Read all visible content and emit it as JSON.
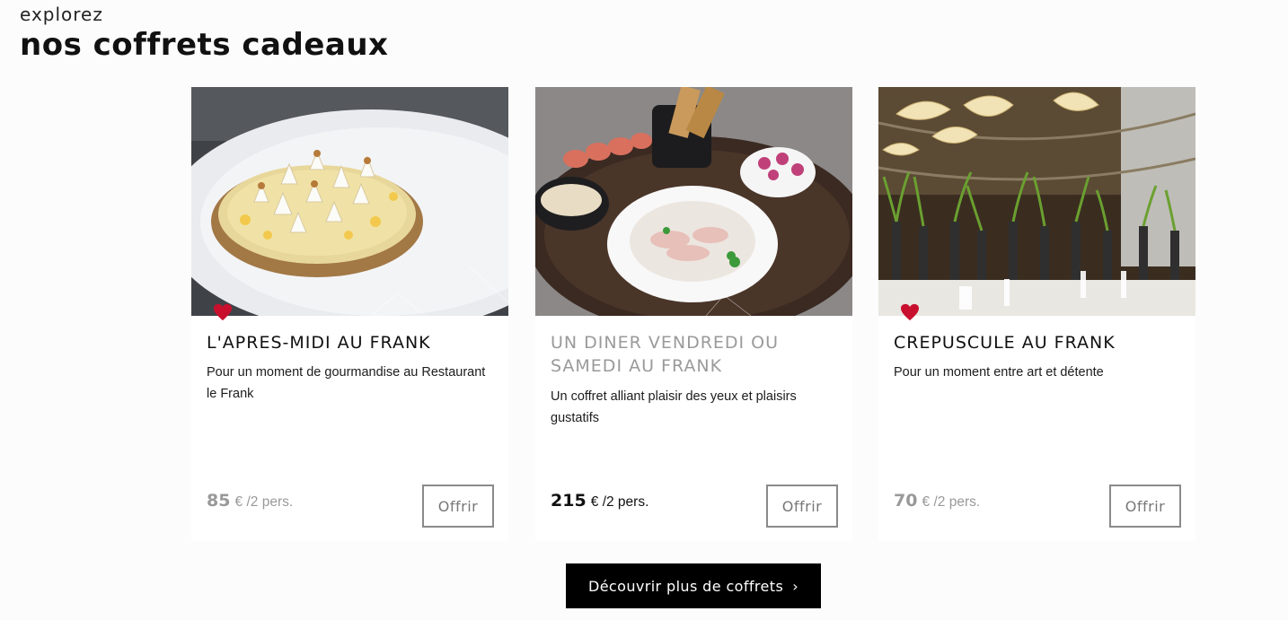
{
  "header": {
    "kicker": "explorez",
    "title": "nos coffrets cadeaux"
  },
  "cards": [
    {
      "title": "L'APRES-MIDI AU FRANK",
      "description": "Pour un moment de gourmandise au Restaurant le Frank",
      "price_amount": "85",
      "price_unit": "€ /2 pers.",
      "offer_label": "Offrir",
      "favorite": true,
      "image_icon": "tart-dessert-photo"
    },
    {
      "title": "UN DINER VENDREDI OU SAMEDI AU FRANK",
      "description": "Un coffret alliant plaisir des yeux et plaisirs gustatifs",
      "price_amount": "215",
      "price_unit": "€ /2 pers.",
      "offer_label": "Offrir",
      "favorite": false,
      "image_icon": "fish-platter-photo"
    },
    {
      "title": "CREPUSCULE AU FRANK",
      "description": "Pour un moment entre art et détente",
      "price_amount": "70",
      "price_unit": "€ /2 pers.",
      "offer_label": "Offrir",
      "favorite": true,
      "image_icon": "restaurant-interior-photo"
    }
  ],
  "more_button": {
    "label": "Découvrir plus de coffrets",
    "icon": "chevron-right-icon"
  },
  "colors": {
    "heart": "#c8102e",
    "button_bg": "#000000",
    "muted_text": "#9a9a9a"
  }
}
